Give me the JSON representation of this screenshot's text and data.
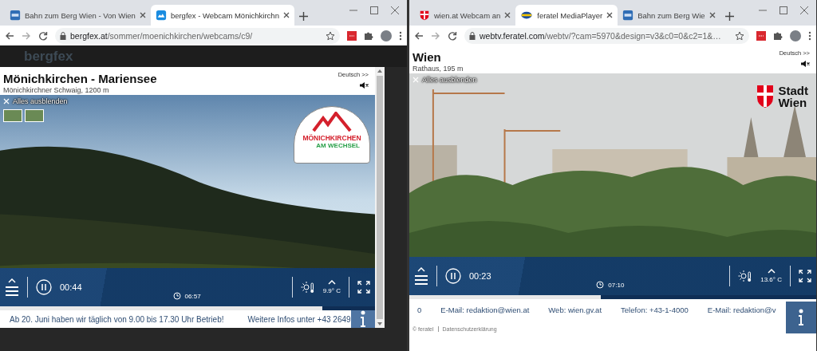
{
  "windows": [
    {
      "tabs": [
        {
          "title": "Bahn zum Berg Wien - Von Wien",
          "selected": false,
          "kind": "bzb"
        },
        {
          "title": "bergfex - Webcam Mönichkirchn",
          "selected": true,
          "kind": "bergfex"
        }
      ],
      "address": {
        "host": "bergfex.at",
        "path": "/sommer/moenichkirchen/webcams/c9/"
      },
      "site_header": {
        "logo": "bergfex"
      },
      "player": {
        "kind": "embedded",
        "title": "Mönichkirchen - Mariensee",
        "subtitle": "Mönichkirchner Schwaig, 1200 m",
        "language": "Deutsch >>",
        "hide_all": "Alles ausblenden",
        "camera": {
          "kind": "forest"
        },
        "thumbnails": true,
        "logo": {
          "kind": "mountain",
          "lines": [
            "MÖNICHKIRCHEN",
            "AM WECHSEL"
          ]
        },
        "elapsed": "00:44",
        "clock": "06:57",
        "temperature": "9.9° C",
        "progress": {
          "level": 0.86
        },
        "ticker": [
          "Ab 20. Juni haben wir täglich von 9.00 bis 17.30 Uhr Betrieb!",
          "Weitere Infos unter +43 2649"
        ],
        "scrollbar": true
      }
    },
    {
      "tabs": [
        {
          "title": "wien.at Webcam an",
          "selected": false,
          "kind": "wien"
        },
        {
          "title": "feratel MediaPlayer",
          "selected": true,
          "kind": "feratel"
        },
        {
          "title": "Bahn zum Berg Wie",
          "selected": false,
          "kind": "bzb"
        }
      ],
      "address": {
        "host": "webtv.feratel.com",
        "path": "/webtv/?cam=5970&design=v3&c0=0&c2=1&…"
      },
      "player": {
        "kind": "full",
        "title": "Wien",
        "subtitle": "Rathaus, 195 m",
        "language": "Deutsch >>",
        "hide_all": "Alles ausblenden",
        "camera": {
          "kind": "city"
        },
        "logo": {
          "kind": "shield",
          "lines": [
            "Stadt",
            "Wien"
          ]
        },
        "elapsed": "00:23",
        "clock": "07:10",
        "temperature": "13.6° C",
        "progress": {
          "level": 0.47
        },
        "ticker": [
          "0",
          "E-Mail: redaktion@wien.at",
          "Web: wien.gv.at",
          "Telefon: +43-1-4000",
          "E-Mail: redaktion@v"
        ]
      },
      "footer": [
        "© feratel",
        "Datenschutzerklärung"
      ]
    }
  ]
}
